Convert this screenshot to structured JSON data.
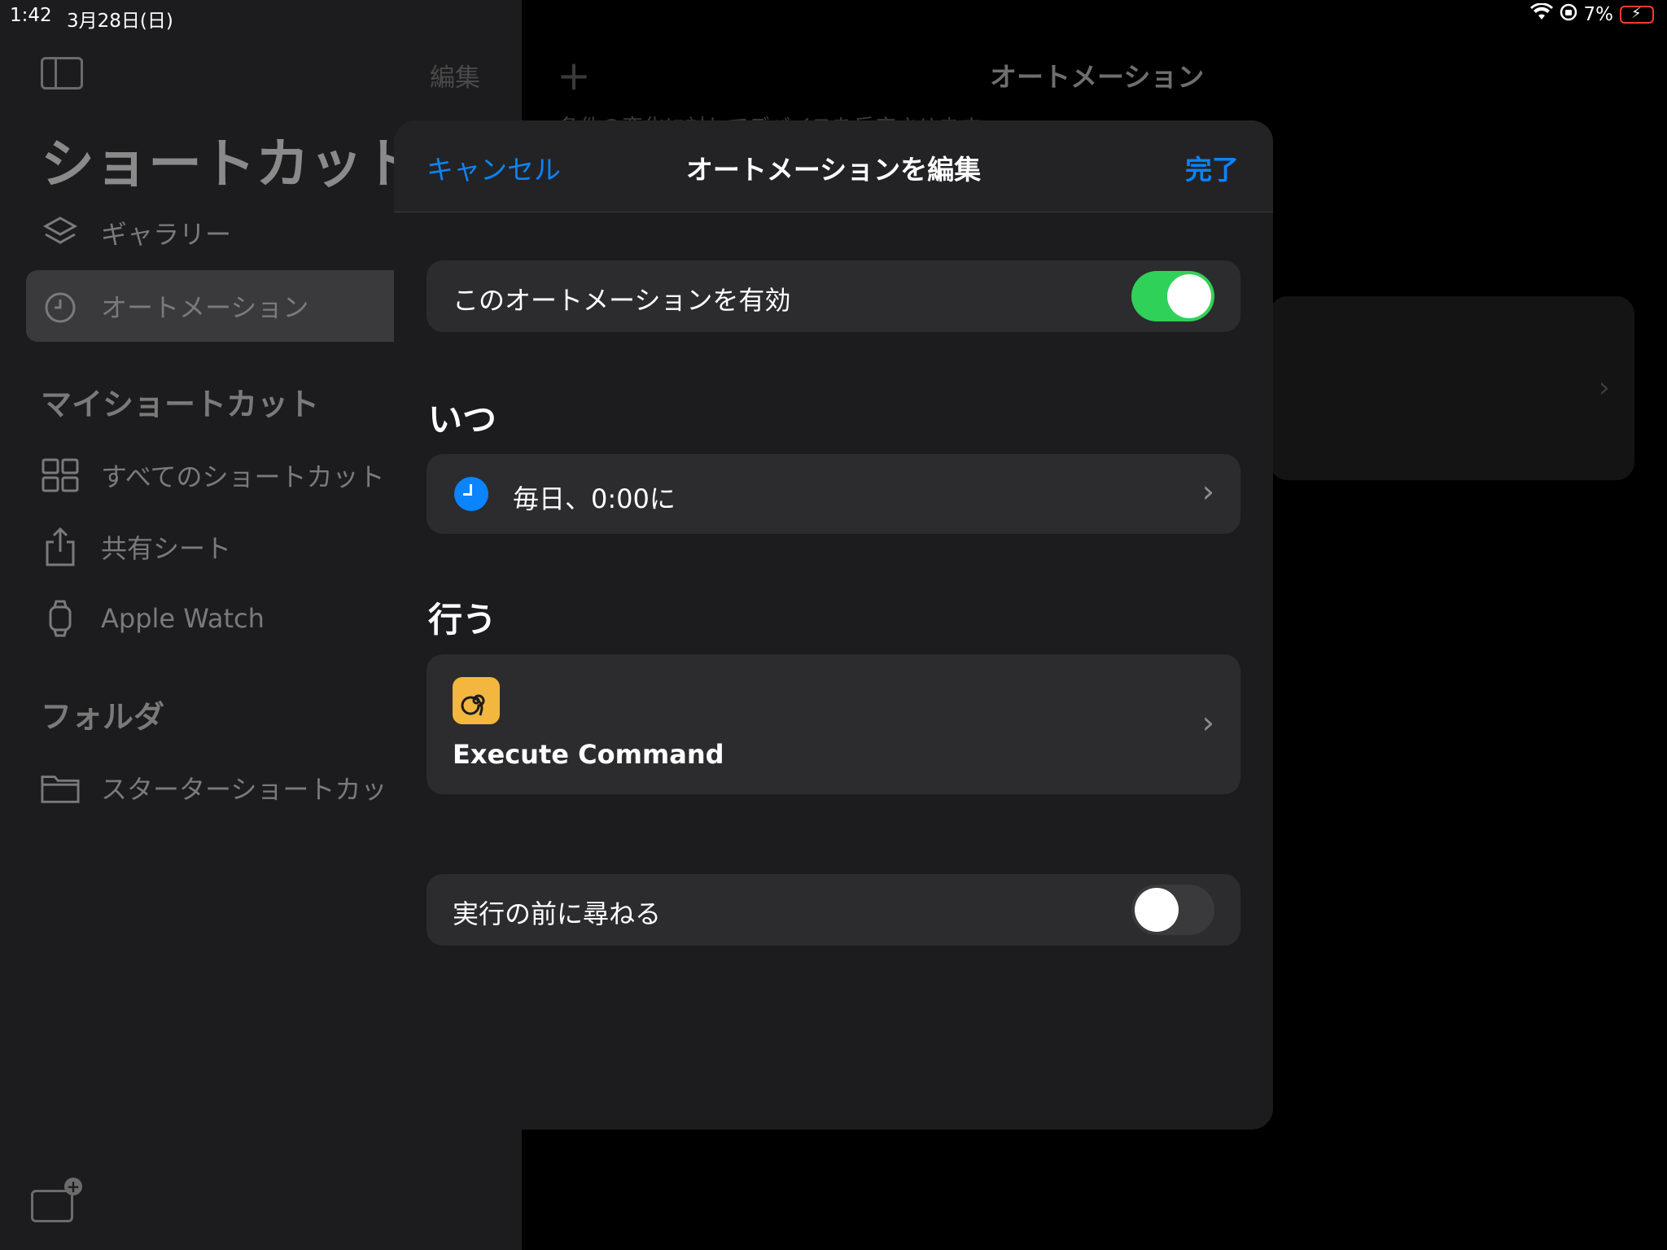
{
  "status_bar": {
    "time": "1:42",
    "date": "3月28日(日)",
    "battery_percent": "7%"
  },
  "sidebar": {
    "edit_label": "編集",
    "title": "ショートカット",
    "items": [
      {
        "label": "ギャラリー",
        "icon": "layers-icon"
      },
      {
        "label": "オートメーション",
        "icon": "clock-icon",
        "selected": true
      }
    ],
    "my_shortcuts_header": "マイショートカット",
    "my_shortcuts": [
      {
        "label": "すべてのショートカット",
        "icon": "grid-icon"
      },
      {
        "label": "共有シート",
        "icon": "share-icon"
      },
      {
        "label": "Apple Watch",
        "icon": "watch-icon"
      }
    ],
    "folders_header": "フォルダ",
    "folders": [
      {
        "label": "スターターショートカット",
        "icon": "folder-icon"
      }
    ]
  },
  "main": {
    "title": "オートメーション",
    "subtitle": "条件の変化に対してデバイスを反応させます。"
  },
  "modal": {
    "cancel_label": "キャンセル",
    "title": "オートメーションを編集",
    "done_label": "完了",
    "enable_label": "このオートメーションを有効",
    "enable_on": true,
    "when_header": "いつ",
    "trigger_label": "毎日、0:00に",
    "do_header": "行う",
    "action_label": "Execute Command",
    "ask_label": "実行の前に尋ねる",
    "ask_on": false
  },
  "colors": {
    "accent": "#0a84ff",
    "toggle_on": "#30d158",
    "app_icon": "#f3b63f"
  }
}
